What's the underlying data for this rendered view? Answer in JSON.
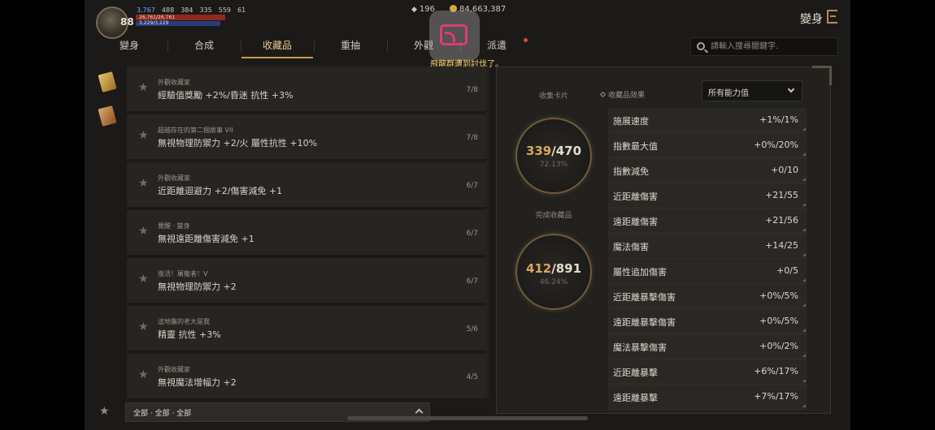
{
  "player": {
    "level": "88",
    "stats": [
      "3,767",
      "488",
      "384",
      "335",
      "559",
      "61"
    ],
    "hp": "26,761/26,761",
    "mp": "3,229/3,229"
  },
  "currency": {
    "gems": "196",
    "gold": "84,663,387"
  },
  "header": {
    "title": "變身"
  },
  "tabs": [
    "變身",
    "合成",
    "收藏品",
    "重抽",
    "外觀",
    "派遣"
  ],
  "active_tab": "收藏品",
  "toast": "飛龍群遭到討伐了。",
  "search": {
    "placeholder": "請輸入搜尋關鍵字."
  },
  "collections": [
    {
      "source": "外觀收藏家",
      "effect": "經驗值獎勵 +2%/昏迷 抗性 +3%",
      "count": "7/8"
    },
    {
      "source": "超越存在的第二個故事 VII",
      "effect": "無視物理防禦力 +2/火 屬性抗性 +10%",
      "count": "7/8"
    },
    {
      "source": "外觀收藏家",
      "effect": "近距離迴避力 +2/傷害減免 +1",
      "count": "6/7"
    },
    {
      "source": "覺醒 · 變身",
      "effect": "無視遠距離傷害減免 +1",
      "count": "6/7"
    },
    {
      "source": "復活！屠龍者！V",
      "effect": "無視物理防禦力 +2",
      "count": "6/7"
    },
    {
      "source": "這地盤的老大是我",
      "effect": "精靈 抗性 +3%",
      "count": "5/6"
    },
    {
      "source": "外觀收藏家",
      "effect": "無視魔法增幅力 +2",
      "count": "4/5"
    }
  ],
  "filter": {
    "text": "全部 · 全部 · 全部"
  },
  "summary": {
    "cards_label": "收集卡片",
    "cards_current": "339",
    "cards_total": "/470",
    "cards_pct": "72.13%",
    "completed_label": "完成收藏品",
    "completed_current": "412",
    "completed_total": "/891",
    "completed_pct": "46.24%"
  },
  "effects": {
    "title": "收藏品效果",
    "dropdown": "所有能力值",
    "rows": [
      {
        "name": "施展速度",
        "value": "+1%/1%"
      },
      {
        "name": "指數最大值",
        "value": "+0%/20%"
      },
      {
        "name": "指數減免",
        "value": "+0/10"
      },
      {
        "name": "近距離傷害",
        "value": "+21/55"
      },
      {
        "name": "遠距離傷害",
        "value": "+21/56"
      },
      {
        "name": "魔法傷害",
        "value": "+14/25"
      },
      {
        "name": "屬性追加傷害",
        "value": "+0/5"
      },
      {
        "name": "近距離暴擊傷害",
        "value": "+0%/5%"
      },
      {
        "name": "遠距離暴擊傷害",
        "value": "+0%/5%"
      },
      {
        "name": "魔法暴擊傷害",
        "value": "+0%/2%"
      },
      {
        "name": "近距離暴擊",
        "value": "+6%/17%"
      },
      {
        "name": "遠距離暴擊",
        "value": "+7%/17%"
      }
    ]
  }
}
